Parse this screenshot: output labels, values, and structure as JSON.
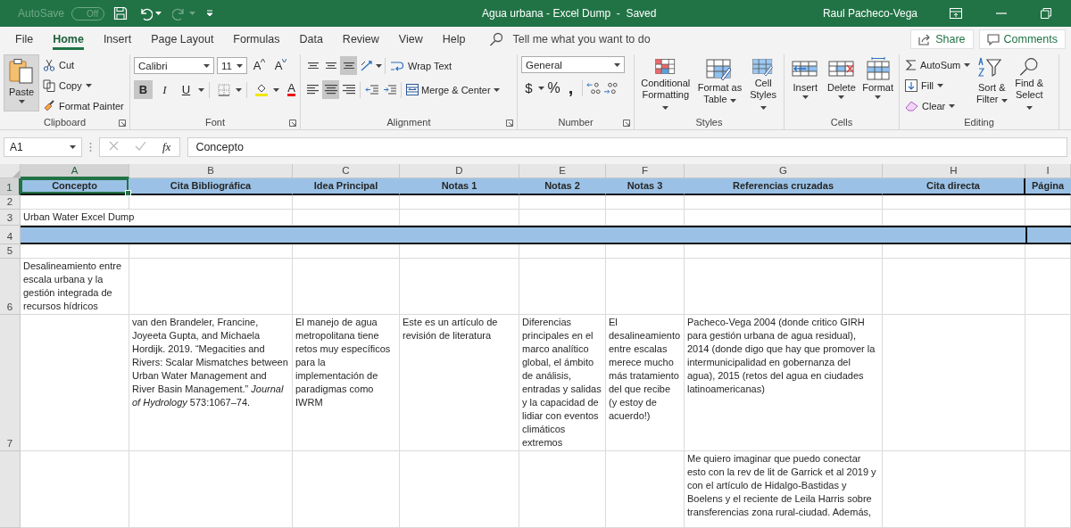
{
  "title_bar": {
    "autosave": {
      "label": "AutoSave",
      "toggle": "Off",
      "on": false
    },
    "redo": {
      "disabled": true
    },
    "title": "Agua urbana - Excel Dump  -  Saved",
    "user": "Raul Pacheco-Vega"
  },
  "menu_tabs": [
    {
      "label": "File",
      "selected": false
    },
    {
      "label": "Home",
      "selected": true
    },
    {
      "label": "Insert",
      "selected": false
    },
    {
      "label": "Page Layout",
      "selected": false
    },
    {
      "label": "Formulas",
      "selected": false
    },
    {
      "label": "Data",
      "selected": false
    },
    {
      "label": "Review",
      "selected": false
    },
    {
      "label": "View",
      "selected": false
    },
    {
      "label": "Help",
      "selected": false
    }
  ],
  "tell_me": {
    "placeholder": "Tell me what you want to do"
  },
  "share_button": "Share",
  "comments_button": "Comments",
  "ribbon": {
    "clipboard": {
      "title": "Clipboard",
      "paste": "Paste",
      "cut": "Cut",
      "copy": "Copy",
      "format_painter": "Format Painter"
    },
    "font": {
      "title": "Font",
      "font_name": "Calibri",
      "font_size": "11",
      "grow": "A",
      "shrink": "A",
      "bold": {
        "label": "B",
        "selected": true
      },
      "italic": {
        "label": "I",
        "selected": false
      },
      "underline": {
        "label": "U",
        "selected": false
      },
      "font_color": "A"
    },
    "alignment": {
      "title": "Alignment",
      "top_align": {
        "selected": false
      },
      "middle_align": {
        "selected": false
      },
      "bottom_align": {
        "selected": true
      },
      "left_align": {
        "selected": false
      },
      "center_align": {
        "selected": true
      },
      "right_align": {
        "selected": false
      },
      "wrap_text": "Wrap Text",
      "merge_center": "Merge & Center"
    },
    "number": {
      "title": "Number",
      "format": "General",
      "currency": "$",
      "percent": "%",
      "comma": ","
    },
    "styles": {
      "title": "Styles",
      "buttons": [
        "Conditional Formatting",
        "Format as Table",
        "Cell Styles"
      ]
    },
    "cells": {
      "title": "Cells",
      "buttons": [
        "Insert",
        "Delete",
        "Format"
      ]
    },
    "editing": {
      "title": "Editing",
      "autosum": "AutoSum",
      "fill": "Fill",
      "clear": "Clear",
      "buttons": [
        "Sort & Filter",
        "Find & Select"
      ]
    }
  },
  "formula_bar": {
    "name_box": "A1",
    "fx": "fx",
    "value": "Concepto",
    "cancel": {
      "disabled": true
    }
  },
  "sheet": {
    "columns": [
      {
        "letter": "A",
        "selected": true
      },
      {
        "letter": "B",
        "selected": false
      },
      {
        "letter": "C",
        "selected": false
      },
      {
        "letter": "D",
        "selected": false
      },
      {
        "letter": "E",
        "selected": false
      },
      {
        "letter": "F",
        "selected": false
      },
      {
        "letter": "G",
        "selected": false
      },
      {
        "letter": "H",
        "selected": false
      },
      {
        "letter": "I",
        "selected": false
      }
    ],
    "rows": [
      {
        "number": "1",
        "selected": true,
        "kind": "header",
        "cells": {
          "A": "Concepto",
          "B": "Cita Bibliográfica",
          "C": "Idea Principal",
          "D": "Notas 1",
          "E": "Notas 2",
          "F": "Notas 3",
          "G": "Referencias cruzadas",
          "H": "Cita directa",
          "I": "Página"
        }
      },
      {
        "number": "2",
        "selected": false,
        "kind": "plain"
      },
      {
        "number": "3",
        "selected": false,
        "kind": "plain",
        "wrap": false,
        "cells": {
          "A": "Urban Water Excel Dump"
        }
      },
      {
        "number": "4",
        "selected": false,
        "kind": "band"
      },
      {
        "number": "5",
        "selected": false,
        "kind": "plain"
      },
      {
        "number": "6",
        "selected": false,
        "kind": "plain",
        "wrap": true,
        "align_top": false,
        "cells": {
          "A": "Desalineamiento entre escala urbana y la gestión integrada de recursos hídricos"
        }
      },
      {
        "number": "7",
        "selected": false,
        "kind": "plain",
        "wrap": true,
        "align_top": true,
        "cells": {
          "B": "van den Brandeler, Francine, Joyeeta Gupta, and Michaela Hordijk. 2019. “Megacities and Rivers: Scalar Mismatches between Urban Water Management and River Basin Management.” *Journal of Hydrology*  573:1067–74.",
          "C": "El manejo de agua metropolitana tiene retos muy específicos para la implementación de paradigmas como IWRM",
          "D": "Este es un artículo de revisión de literatura",
          "E": "Diferencias principales en el marco analítico global, el ámbito de análisis, entradas y salidas y la capacidad de lidiar con eventos climáticos extremos",
          "F": "El desalineamiento entre escalas merece mucho más tratamiento del que recibe (y estoy de acuerdo!)",
          "G": "Pacheco-Vega 2004 (donde critico GIRH para gestión urbana de agua residual), 2014 (donde digo que hay que promover la intermunicipalidad en gobernanza del agua), 2015 (retos del agua en ciudades latinoamericanas)"
        }
      },
      {
        "selected": false,
        "kind": "plain",
        "wrap": true,
        "align_top": true,
        "cells": {
          "G": "Me quiero imaginar que puedo conectar esto con la rev de lit de Garrick et al 2019 y con el artículo de Hidalgo-Bastidas y Boelens y el reciente de Leila Harris sobre transferencias zona rural-ciudad. Además,"
        }
      }
    ]
  }
}
